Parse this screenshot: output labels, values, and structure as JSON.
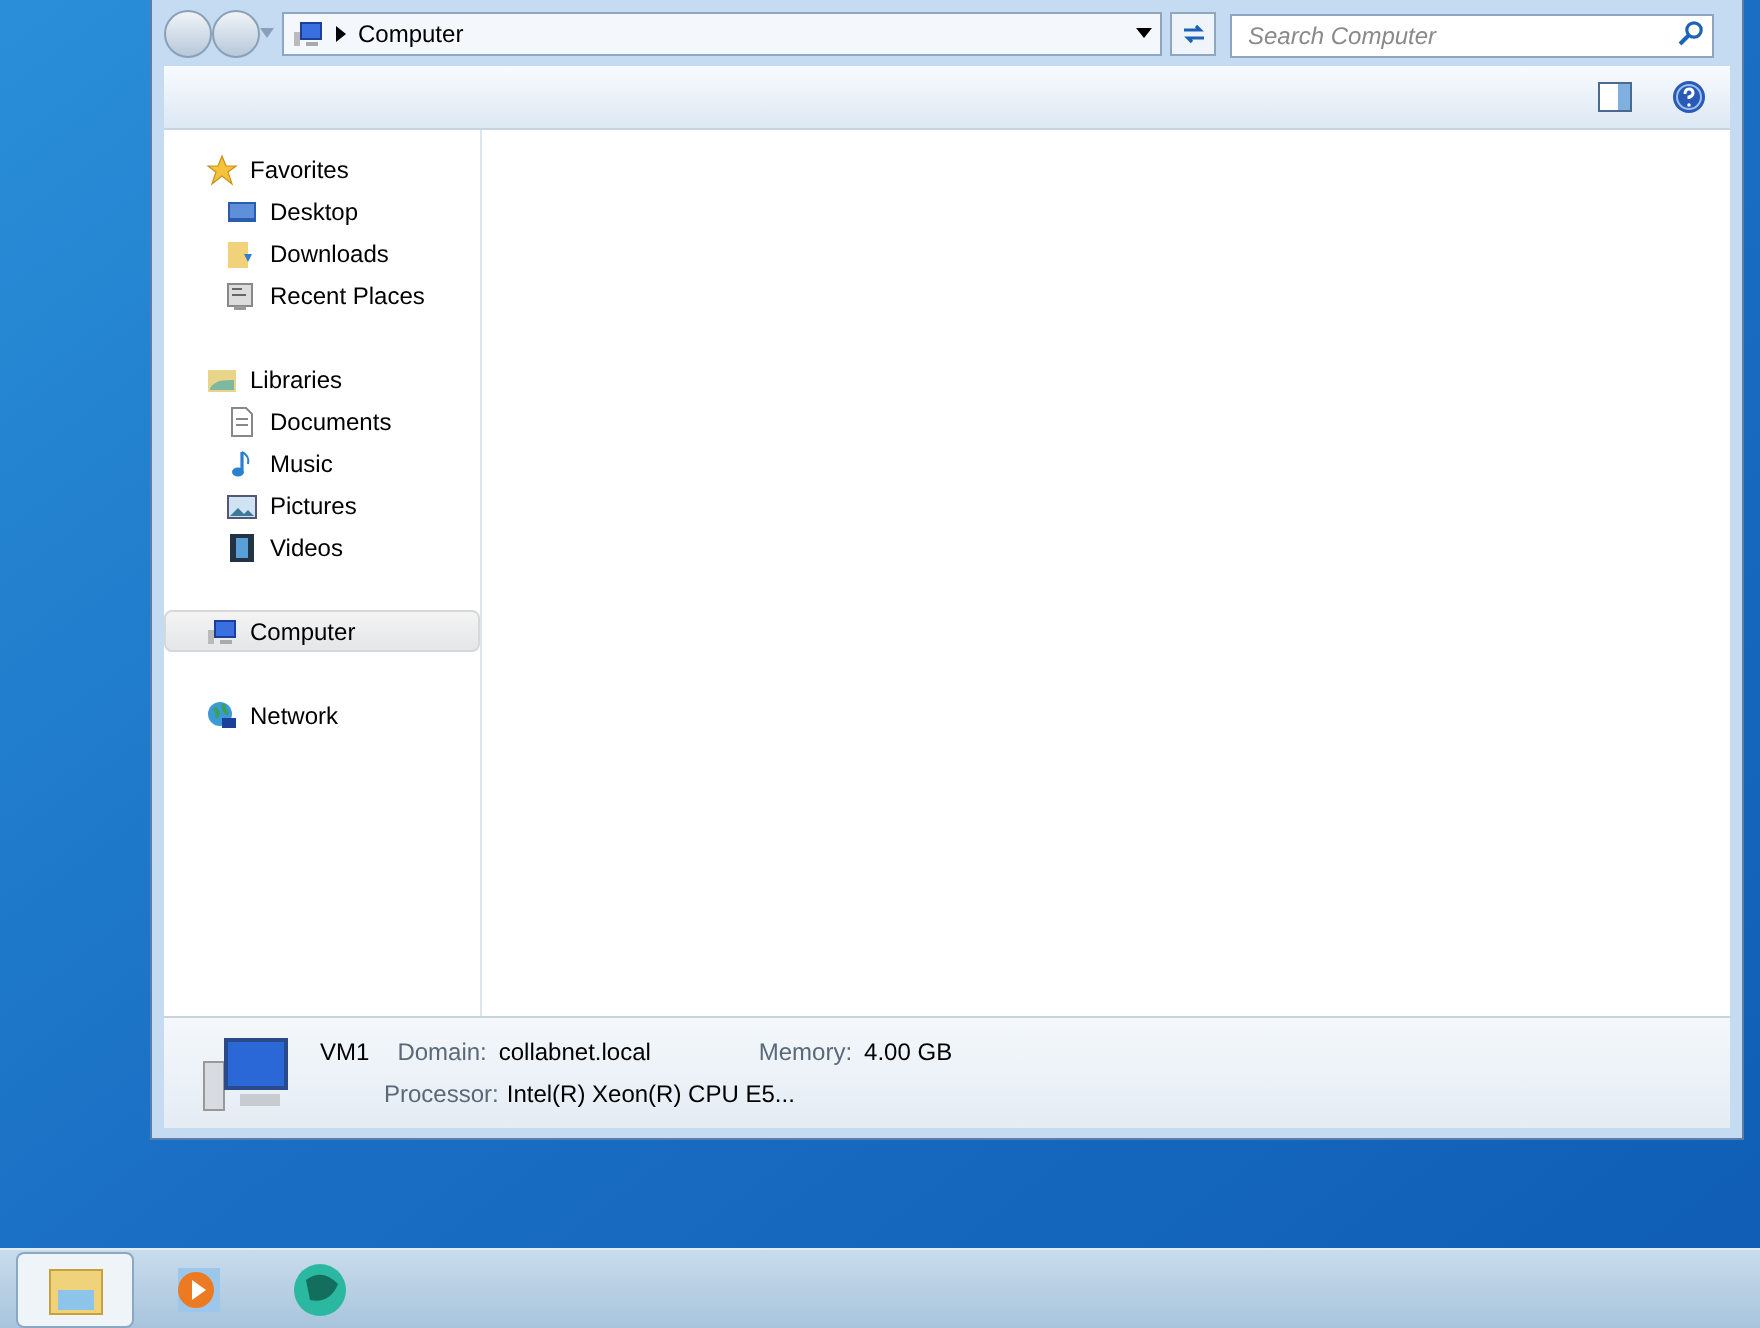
{
  "address_bar": {
    "location": "Computer"
  },
  "search": {
    "placeholder": "Search Computer"
  },
  "navigation": [
    {
      "label": "Favorites",
      "kind": "star",
      "selected": false,
      "children": [
        {
          "label": "Desktop",
          "kind": "desktop",
          "selected": false
        },
        {
          "label": "Downloads",
          "kind": "downloads",
          "selected": false
        },
        {
          "label": "Recent Places",
          "kind": "recent",
          "selected": false
        }
      ]
    },
    {
      "label": "Libraries",
      "kind": "libraries",
      "selected": false,
      "children": [
        {
          "label": "Documents",
          "kind": "documents",
          "selected": false
        },
        {
          "label": "Music",
          "kind": "music",
          "selected": false
        },
        {
          "label": "Pictures",
          "kind": "pictures",
          "selected": false
        },
        {
          "label": "Videos",
          "kind": "videos",
          "selected": false
        }
      ]
    },
    {
      "label": "Computer",
      "kind": "computer",
      "selected": true
    },
    {
      "label": "Network",
      "kind": "network",
      "selected": false
    }
  ],
  "details": {
    "name": "VM1",
    "fields": [
      {
        "label": "Domain:",
        "value": "collabnet.local"
      },
      {
        "label": "Memory:",
        "value": "4.00 GB"
      },
      {
        "label": "Processor:",
        "value": "Intel(R) Xeon(R) CPU E5..."
      }
    ]
  },
  "taskbar": [
    {
      "kind": "explorer",
      "selected": true
    },
    {
      "kind": "media",
      "selected": false
    },
    {
      "kind": "globe",
      "selected": false
    }
  ]
}
